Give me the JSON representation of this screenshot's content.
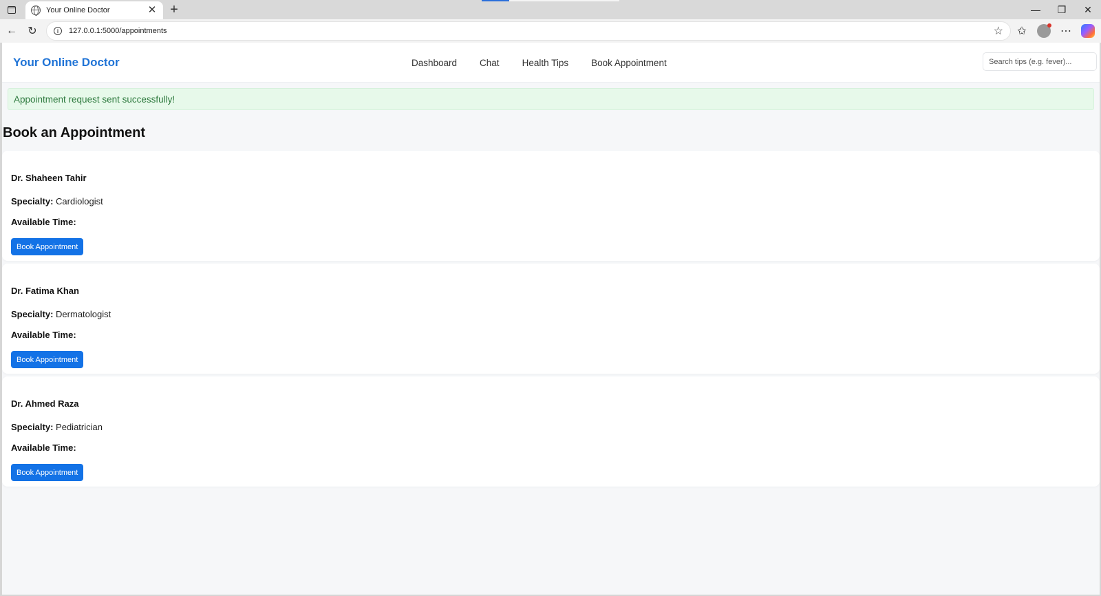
{
  "browser": {
    "tab_title": "Your Online Doctor",
    "url": "127.0.0.1:5000/appointments"
  },
  "site": {
    "brand": "Your Online Doctor",
    "nav": [
      "Dashboard",
      "Chat",
      "Health Tips",
      "Book Appointment"
    ],
    "search_placeholder": "Search tips (e.g. fever)..."
  },
  "flash": "Appointment request sent successfully!",
  "heading": "Book an Appointment",
  "labels": {
    "specialty": "Specialty:",
    "available_time": "Available Time:",
    "book_button": "Book Appointment"
  },
  "doctors": [
    {
      "name": "Dr. Shaheen Tahir",
      "specialty": "Cardiologist",
      "available_time": ""
    },
    {
      "name": "Dr. Fatima Khan",
      "specialty": "Dermatologist",
      "available_time": ""
    },
    {
      "name": "Dr. Ahmed Raza",
      "specialty": "Pediatrician",
      "available_time": ""
    }
  ],
  "colors": {
    "brand": "#1f73d6",
    "button": "#1372e6",
    "flash_bg": "#e7f9ea",
    "flash_text": "#2e7a3e"
  }
}
